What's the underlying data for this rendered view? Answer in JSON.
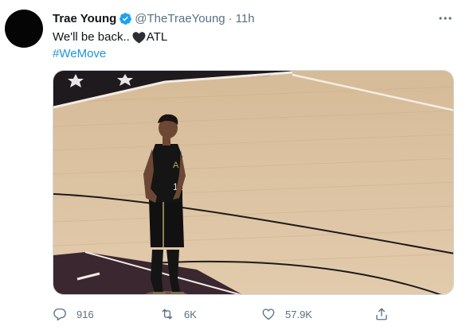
{
  "tweet": {
    "display_name": "Trae Young",
    "handle": "@TheTraeYoung",
    "separator": "·",
    "time": "11h",
    "text_before_emoji": "We'll be back..",
    "emoji": "black-heart-icon",
    "text_after_emoji": "ATL",
    "hashtag": "#WeMove",
    "media_alt": "player-on-basketball-court-photo"
  },
  "actions": {
    "reply_count": "916",
    "retweet_count": "6K",
    "like_count": "57.9K"
  },
  "colors": {
    "verified_blue": "#1da1f2",
    "link_blue": "#1b95e0",
    "muted_gray": "#5b7083",
    "court_wood": "#dcc3a2",
    "court_purple": "#3a2730"
  }
}
